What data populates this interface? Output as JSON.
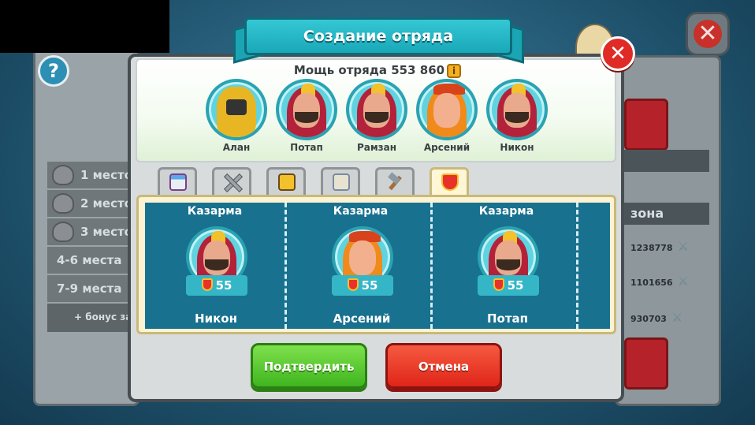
{
  "dialog": {
    "title": "Создание отряда",
    "close_label": "✕"
  },
  "squad": {
    "power_label": "Мощь отряда 553 860",
    "info_icon": "i",
    "heroes": [
      {
        "name": "Алан",
        "icon": "knight-portrait"
      },
      {
        "name": "Потап",
        "icon": "hooded-bandit-portrait"
      },
      {
        "name": "Рамзан",
        "icon": "hooded-bandit-portrait"
      },
      {
        "name": "Арсений",
        "icon": "king-portrait"
      },
      {
        "name": "Никон",
        "icon": "hooded-bandit-portrait"
      }
    ]
  },
  "tabs": [
    {
      "icon": "castle-icon",
      "active": false
    },
    {
      "icon": "swords-icon",
      "active": false
    },
    {
      "icon": "book-icon",
      "active": false
    },
    {
      "icon": "map-icon",
      "active": false
    },
    {
      "icon": "hammer-icon",
      "active": false
    },
    {
      "icon": "shield-icon",
      "active": true
    }
  ],
  "units": [
    {
      "type": "Казарма",
      "level": "55",
      "name": "Никон",
      "icon": "hooded-bandit-portrait"
    },
    {
      "type": "Казарма",
      "level": "55",
      "name": "Арсений",
      "icon": "king-portrait"
    },
    {
      "type": "Казарма",
      "level": "55",
      "name": "Потап",
      "icon": "hooded-bandit-portrait"
    }
  ],
  "buttons": {
    "confirm": "Подтвердить",
    "cancel": "Отмена"
  },
  "background": {
    "help": "?",
    "close": "✕",
    "ranks": [
      "1 место",
      "2 место",
      "3 место",
      "4-6 места",
      "7-9 места",
      "+ бонус за"
    ],
    "right_bar": "зона",
    "scores": [
      "1238778",
      "1101656",
      "930703"
    ]
  },
  "colors": {
    "ribbon": "#1ba5b4",
    "units_bg": "#18718f",
    "confirm": "#3fb51f",
    "cancel": "#e02519",
    "close": "#e02a25"
  }
}
